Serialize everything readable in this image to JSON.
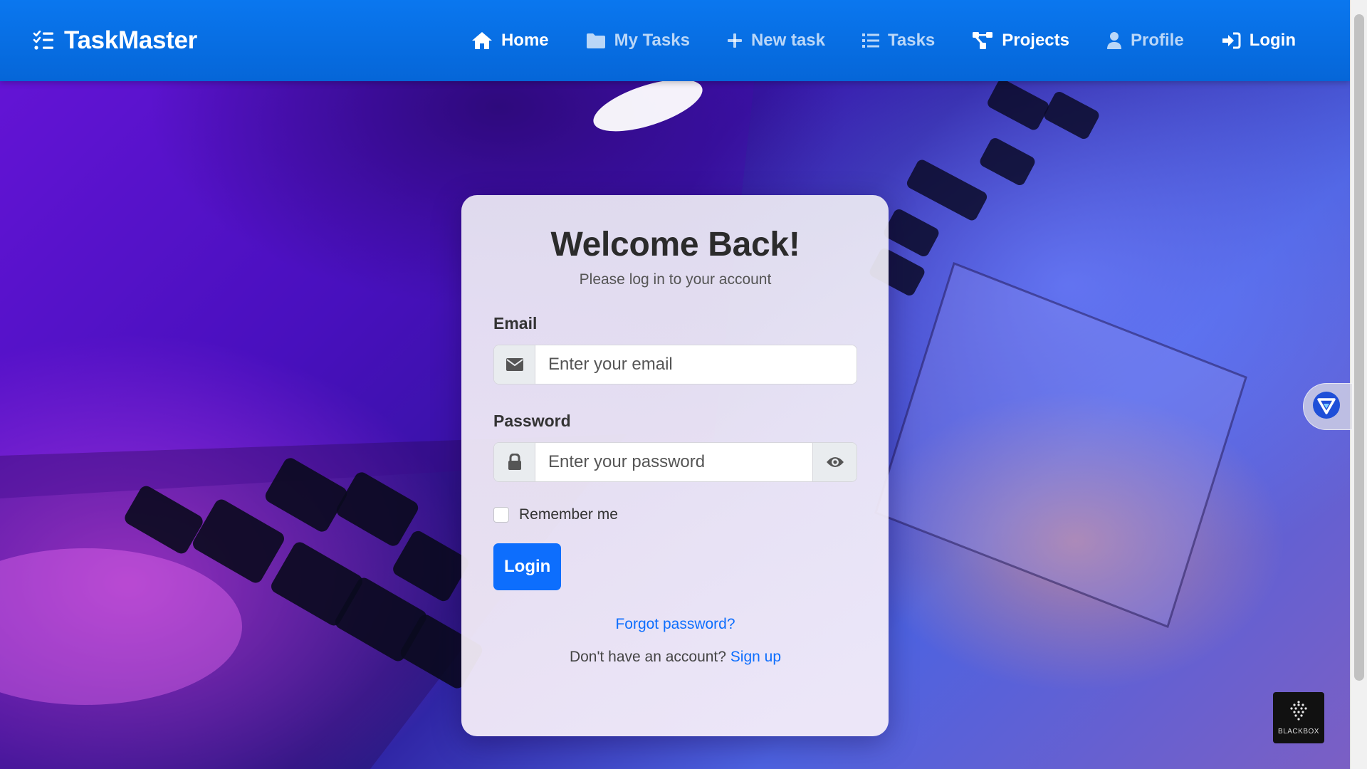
{
  "navbar": {
    "brand": "TaskMaster",
    "links": [
      {
        "label": "Home",
        "icon": "home-icon",
        "active": true
      },
      {
        "label": "My Tasks",
        "icon": "folder-icon"
      },
      {
        "label": "New task",
        "icon": "plus-icon"
      },
      {
        "label": "Tasks",
        "icon": "list-icon"
      },
      {
        "label": "Projects",
        "icon": "project-diagram-icon",
        "active": true
      },
      {
        "label": "Profile",
        "icon": "user-icon"
      },
      {
        "label": "Login",
        "icon": "sign-in-icon",
        "active": true
      }
    ]
  },
  "login_card": {
    "title": "Welcome Back!",
    "subtitle": "Please log in to your account",
    "email": {
      "label": "Email",
      "placeholder": "Enter your email",
      "value": ""
    },
    "password": {
      "label": "Password",
      "placeholder": "Enter your password",
      "value": ""
    },
    "remember_me": {
      "label": "Remember me",
      "checked": false
    },
    "submit_label": "Login",
    "forgot_password": "Forgot password?",
    "signup_prompt": "Don't have an account?",
    "signup_link": "Sign up"
  },
  "widgets": {
    "blackbox_label": "BLACKBOX"
  },
  "colors": {
    "navbar": "#0a6fe6",
    "primary": "#0d6efd",
    "card_bg": "#f0ecf5"
  }
}
